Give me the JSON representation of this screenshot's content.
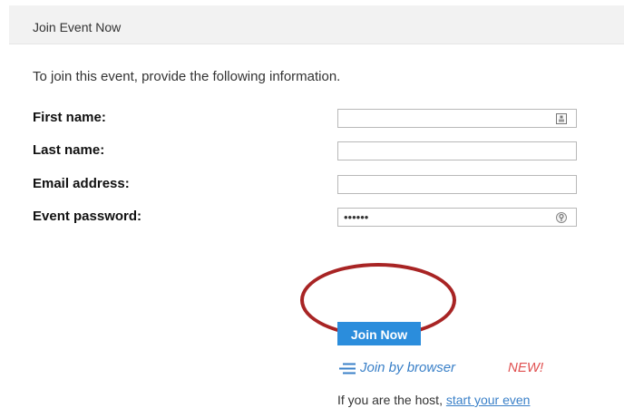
{
  "header": {
    "title": "Join Event Now"
  },
  "intro": "To join this event, provide the following information.",
  "form": {
    "first_name": {
      "label": "First name:",
      "value": ""
    },
    "last_name": {
      "label": "Last name:",
      "value": ""
    },
    "email": {
      "label": "Email address:",
      "value": ""
    },
    "password": {
      "label": "Event password:",
      "value": "••••••"
    }
  },
  "join_button": "Join Now",
  "join_browser": {
    "label": "Join by browser",
    "badge": "NEW!"
  },
  "host": {
    "text": "If you are the host, ",
    "link": "start your even"
  },
  "colors": {
    "accent": "#2b8ddc",
    "link": "#3a80c8",
    "badge": "#e05050",
    "highlight": "#a82424"
  },
  "icons": {
    "first_name_field": "contact-card-icon",
    "password_field": "key-icon",
    "join_browser": "browser-lines-icon"
  }
}
